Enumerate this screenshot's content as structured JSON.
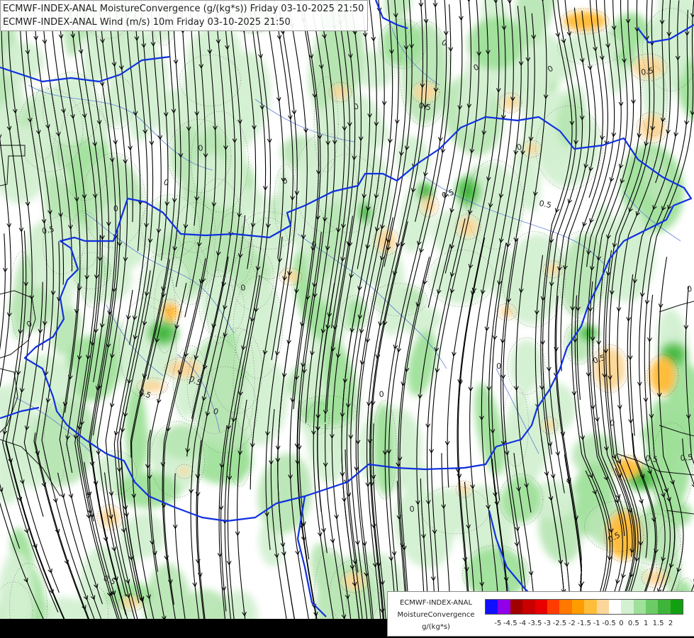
{
  "header": {
    "line1": "ECMWF-INDEX-ANAL MoistureConvergence (g/(kg*s)) Friday 03-10-2025 21:50",
    "line2": "ECMWF-INDEX-ANAL Wind (m/s) 10m Friday 03-10-2025 21:50"
  },
  "map": {
    "contour_labels": [
      "0",
      "0",
      "0",
      "0",
      "0",
      "0",
      "0",
      "0",
      "0",
      "0",
      "0",
      "0",
      "0",
      "0",
      "0",
      "0",
      "0",
      "0",
      "0",
      "0.5",
      "0.5",
      "0.5",
      "0.5",
      "0.5",
      "0.5",
      "0.5",
      "0.5",
      "0.5",
      "0.5",
      "0.5",
      "0.5"
    ],
    "colors": {
      "border": "#1030e0",
      "river": "#5a7ad8",
      "streamline": "#000000",
      "land_boundary": "#101010"
    }
  },
  "legend": {
    "model": "ECMWF-INDEX-ANAL",
    "variable": "MoistureConvergence",
    "unit": "g/(kg*s)",
    "colors": [
      "#1010ff",
      "#9000e8",
      "#a00000",
      "#c80000",
      "#e80000",
      "#ff3c00",
      "#ff7800",
      "#ff9d00",
      "#ffbd3c",
      "#fbd79a",
      "#ffffff",
      "#d3f0d1",
      "#9fe09a",
      "#6ccb66",
      "#3eb43a",
      "#12a012"
    ],
    "ticks": [
      "-5",
      "-4.5",
      "-4",
      "-3.5",
      "-3",
      "-2.5",
      "-2",
      "-1.5",
      "-1",
      "-0.5",
      "0",
      "0.5",
      "1",
      "1.5",
      "2"
    ]
  }
}
